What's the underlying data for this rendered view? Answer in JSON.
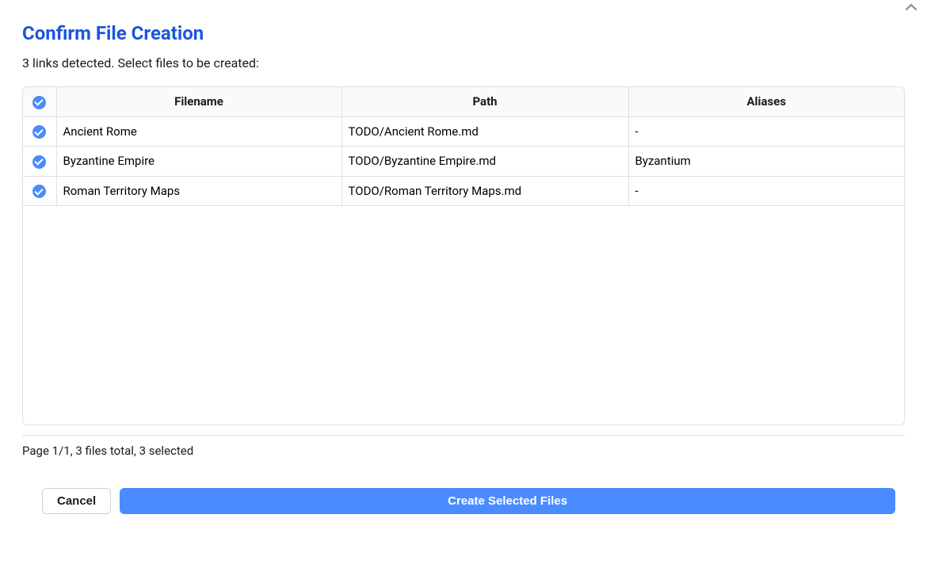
{
  "modal": {
    "title": "Confirm File Creation",
    "subtitle": "3 links detected. Select files to be created:",
    "status": "Page 1/1, 3 files total, 3 selected"
  },
  "table": {
    "headers": {
      "filename": "Filename",
      "path": "Path",
      "aliases": "Aliases"
    },
    "rows": [
      {
        "checked": true,
        "filename": "Ancient Rome",
        "path": "TODO/Ancient Rome.md",
        "aliases": "-"
      },
      {
        "checked": true,
        "filename": "Byzantine Empire",
        "path": "TODO/Byzantine Empire.md",
        "aliases": "Byzantium"
      },
      {
        "checked": true,
        "filename": "Roman Territory Maps",
        "path": "TODO/Roman Territory Maps.md",
        "aliases": "-"
      }
    ]
  },
  "buttons": {
    "cancel": "Cancel",
    "create": "Create Selected Files"
  }
}
